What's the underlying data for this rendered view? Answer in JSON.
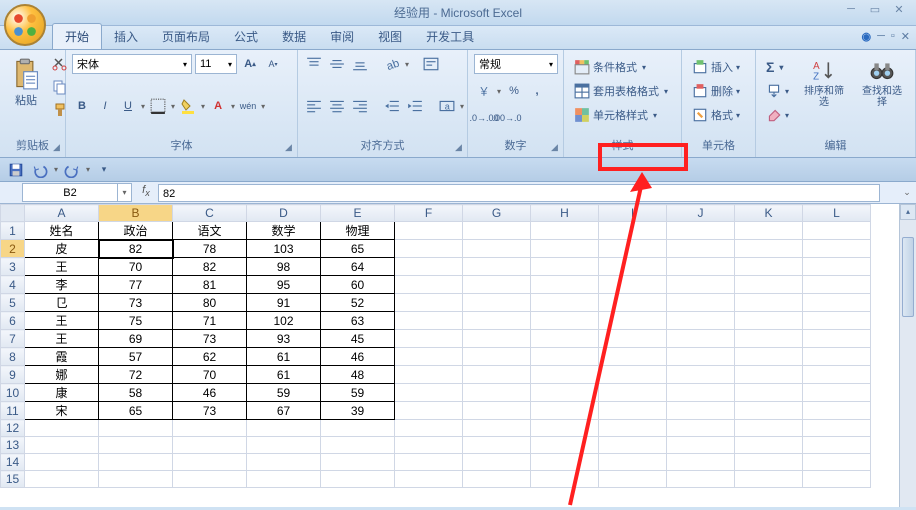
{
  "app": {
    "title": "经验用 - Microsoft Excel"
  },
  "tabs": [
    "开始",
    "插入",
    "页面布局",
    "公式",
    "数据",
    "审阅",
    "视图",
    "开发工具"
  ],
  "active_tab": 0,
  "ribbon": {
    "clipboard": {
      "label": "剪贴板",
      "paste": "粘贴"
    },
    "font": {
      "label": "字体",
      "name": "宋体",
      "size": "11"
    },
    "align": {
      "label": "对齐方式"
    },
    "number": {
      "label": "数字",
      "format": "常规"
    },
    "styles": {
      "label": "样式",
      "cond_fmt": "条件格式",
      "table_fmt": "套用表格格式",
      "cell_style": "单元格样式"
    },
    "cells": {
      "label": "单元格",
      "insert": "插入",
      "delete": "删除",
      "format": "格式"
    },
    "editing": {
      "label": "编辑",
      "sort": "排序和筛选",
      "find": "查找和选择"
    }
  },
  "formula_bar": {
    "cell_ref": "B2",
    "value": "82"
  },
  "columns": [
    "A",
    "B",
    "C",
    "D",
    "E",
    "F",
    "G",
    "H",
    "I",
    "J",
    "K",
    "L"
  ],
  "col_widths_data": 74,
  "data_cols": 5,
  "visible_rows": 15,
  "data": {
    "headers": [
      "姓名",
      "政治",
      "语文",
      "数学",
      "物理"
    ],
    "rows": [
      [
        "皮",
        "82",
        "78",
        "103",
        "65"
      ],
      [
        "王",
        "70",
        "82",
        "98",
        "64"
      ],
      [
        "李",
        "77",
        "81",
        "95",
        "60"
      ],
      [
        "㔾",
        "73",
        "80",
        "91",
        "52"
      ],
      [
        "王",
        "75",
        "71",
        "102",
        "63"
      ],
      [
        "王",
        "69",
        "73",
        "93",
        "45"
      ],
      [
        "霞",
        "57",
        "62",
        "61",
        "46"
      ],
      [
        "娜",
        "72",
        "70",
        "61",
        "48"
      ],
      [
        "康",
        "58",
        "46",
        "59",
        "59"
      ],
      [
        "宋",
        "65",
        "73",
        "67",
        "39"
      ]
    ]
  },
  "active_cell": {
    "row": 2,
    "col": 2
  }
}
